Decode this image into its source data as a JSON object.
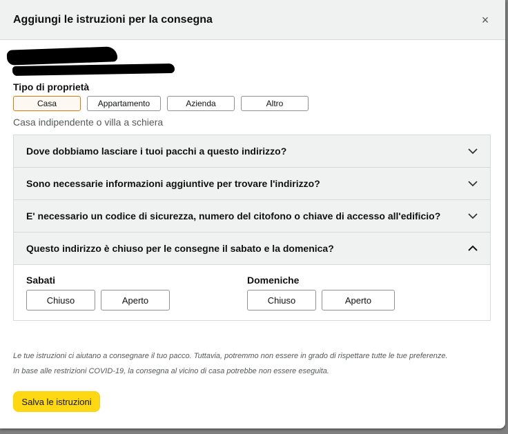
{
  "modal": {
    "title": "Aggiungi le istruzioni per la consegna",
    "close": "×"
  },
  "property": {
    "label": "Tipo di proprietà",
    "options": [
      "Casa",
      "Appartamento",
      "Azienda",
      "Altro"
    ],
    "selected": "Casa",
    "description": "Casa indipendente o villa a schiera"
  },
  "accordion": {
    "items": [
      {
        "question": "Dove dobbiamo lasciare i tuoi pacchi a questo indirizzo?",
        "icon": "chevron-down-icon"
      },
      {
        "question": "Sono necessarie informazioni aggiuntive per trovare l'indirizzo?",
        "icon": "chevron-down-icon"
      },
      {
        "question": "E' necessario un codice di sicurezza, numero del citofono o chiave di accesso all'edificio?",
        "icon": "chevron-down-icon"
      },
      {
        "question": "Questo indirizzo è chiuso per le consegne il sabato e la domenica?",
        "icon": "chevron-up-icon"
      }
    ],
    "weekend": {
      "saturday": {
        "label": "Sabati",
        "closed": "Chiuso",
        "open": "Aperto"
      },
      "sunday": {
        "label": "Domeniche",
        "closed": "Chiuso",
        "open": "Aperto"
      }
    }
  },
  "note": {
    "line1": "Le tue istruzioni ci aiutano a consegnare il tuo pacco. Tuttavia, potremmo non essere in grado di rispettare tutte le tue preferenze.",
    "line2": "In base alle restrizioni COVID-19, la consegna al vicino di casa potrebbe non essere eseguita."
  },
  "save_label": "Salva le istruzioni",
  "colors": {
    "accent": "#ffd814",
    "selected_border": "#e77600",
    "header_bg": "#f0f2f2"
  }
}
